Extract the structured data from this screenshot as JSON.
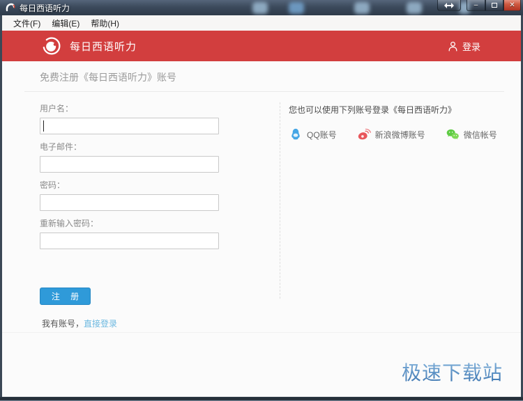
{
  "window": {
    "title": "每日西语听力",
    "controls": {
      "minimize": "–",
      "close": "✕"
    }
  },
  "menu": {
    "items": [
      {
        "label": "文件(F)"
      },
      {
        "label": "编辑(E)"
      },
      {
        "label": "帮助(H)"
      }
    ]
  },
  "header": {
    "app_title": "每日西语听力",
    "login_label": "登录",
    "accent_color": "#d23e3e"
  },
  "main": {
    "heading": "免费注册《每日西语听力》账号",
    "form": {
      "fields": [
        {
          "label": "用户名：",
          "value": ""
        },
        {
          "label": "电子邮件：",
          "value": ""
        },
        {
          "label": "密码：",
          "value": ""
        },
        {
          "label": "重新输入密码：",
          "value": ""
        }
      ],
      "submit_label": "注 册",
      "submit_color": "#2f9ad9"
    },
    "social": {
      "title": "您也可以使用下列账号登录《每日西语听力》",
      "options": [
        {
          "icon": "qq-icon",
          "label": "QQ账号",
          "color": "#45a6e5"
        },
        {
          "icon": "weibo-icon",
          "label": "新浪微博账号",
          "color": "#e8575c"
        },
        {
          "icon": "wechat-icon",
          "label": "微信帐号",
          "color": "#5ecb43"
        }
      ]
    },
    "footer": {
      "have_account_text": "我有账号，",
      "login_link_label": "直接登录",
      "link_color": "#6cb8e0"
    }
  },
  "watermark": "极速下载站"
}
